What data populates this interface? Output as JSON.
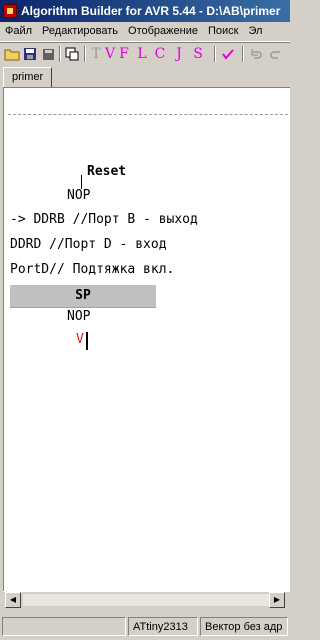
{
  "window": {
    "title": "Algorithm Builder for AVR 5.44 - D:\\AB\\primer"
  },
  "menu": {
    "items": [
      "Файл",
      "Редактировать",
      "Отображение",
      "Поиск",
      "Эл"
    ]
  },
  "toolbar": {
    "icons": [
      "open-folder-icon",
      "save-icon",
      "save-all-icon",
      "copy-window-icon"
    ],
    "letters": [
      "T",
      "V",
      "F",
      "L",
      "C",
      "J",
      "S"
    ],
    "check_icon": "checkmark-icon",
    "accent_color": "#e000e0"
  },
  "tabs": [
    {
      "label": "primer",
      "active": true
    }
  ],
  "editor": {
    "label_reset": "Reset",
    "line_nop1": "NOP",
    "line_ddrb": " -> DDRB //Порт B - выход",
    "line_ddrd": "DDRD //Порт D - вход",
    "line_portd": " PortD// Подтяжка вкл.",
    "sp_block": "SP",
    "line_nop2": "NOP",
    "red_v": "V"
  },
  "statusbar": {
    "panel_empty": "",
    "device": "ATtiny2313",
    "info": "Вектор без адр"
  }
}
